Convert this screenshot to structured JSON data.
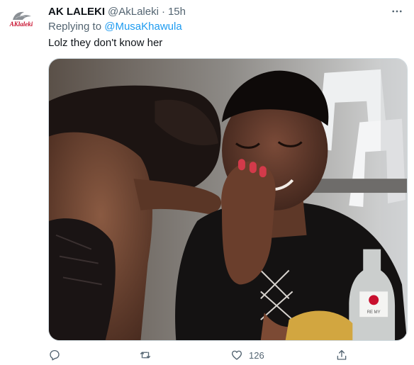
{
  "tweet": {
    "author_name": "AK LALEKI",
    "author_handle": "@AkLaleki",
    "separator": "·",
    "time": "15h",
    "avatar_logo_text": "AKlaleki",
    "reply_prefix": "Replying to",
    "reply_to": "@MusaKhawula",
    "text": "Lolz they don't know her",
    "media_bottle_label": "RE MY"
  },
  "actions": {
    "reply_icon": "reply-icon",
    "retweet_icon": "retweet-icon",
    "like_icon": "heart-icon",
    "like_count": "126",
    "share_icon": "share-icon"
  },
  "colors": {
    "primary_text": "#0f1419",
    "secondary_text": "#536471",
    "link": "#1d9bf0",
    "brand_red": "#c8102e"
  }
}
